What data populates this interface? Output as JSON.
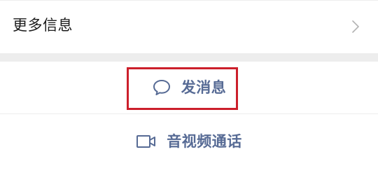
{
  "more_info": {
    "label": "更多信息",
    "chevron_icon": "chevron-right-icon"
  },
  "actions": {
    "send_message": {
      "label": "发消息",
      "icon": "chat-bubble-icon"
    },
    "av_call": {
      "label": "音视频通话",
      "icon": "video-camera-icon"
    }
  },
  "colors": {
    "link_blue": "#576b95",
    "highlight_red": "#cc1f2b",
    "separator_gray": "#ededed"
  }
}
